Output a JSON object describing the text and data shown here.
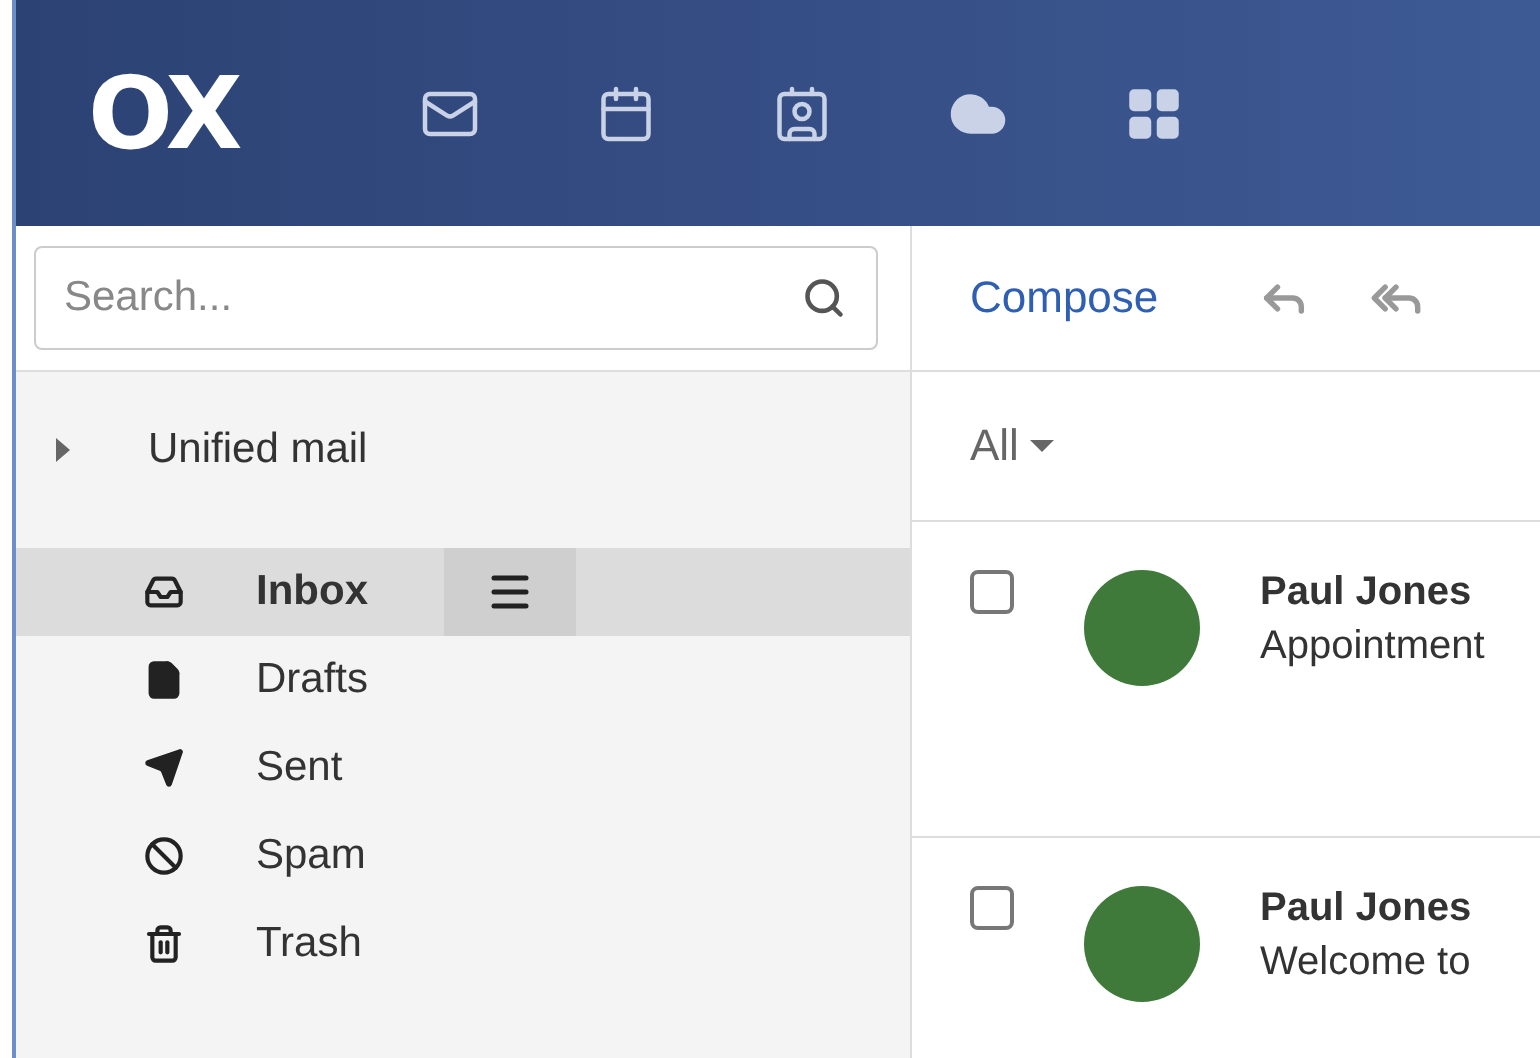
{
  "header": {
    "logo": "OX",
    "apps": [
      {
        "kind": "mail"
      },
      {
        "kind": "calendar"
      },
      {
        "kind": "contacts"
      },
      {
        "kind": "drive"
      },
      {
        "kind": "apps"
      }
    ]
  },
  "sidebar": {
    "search": {
      "placeholder": "Search..."
    },
    "unified": {
      "label": "Unified mail",
      "expanded": false
    },
    "folders": [
      {
        "kind": "inbox",
        "label": "Inbox",
        "selected": true
      },
      {
        "kind": "drafts",
        "label": "Drafts",
        "selected": false
      },
      {
        "kind": "sent",
        "label": "Sent",
        "selected": false
      },
      {
        "kind": "spam",
        "label": "Spam",
        "selected": false
      },
      {
        "kind": "trash",
        "label": "Trash",
        "selected": false
      }
    ]
  },
  "toolbar": {
    "compose": "Compose",
    "actions": [
      {
        "kind": "reply"
      },
      {
        "kind": "reply-all"
      }
    ]
  },
  "filter": {
    "label": "All"
  },
  "messages": [
    {
      "sender": "Paul Jones",
      "subject": "Appointment",
      "checked": false
    },
    {
      "sender": "Paul Jones",
      "subject": "Welcome to",
      "checked": false
    }
  ]
}
